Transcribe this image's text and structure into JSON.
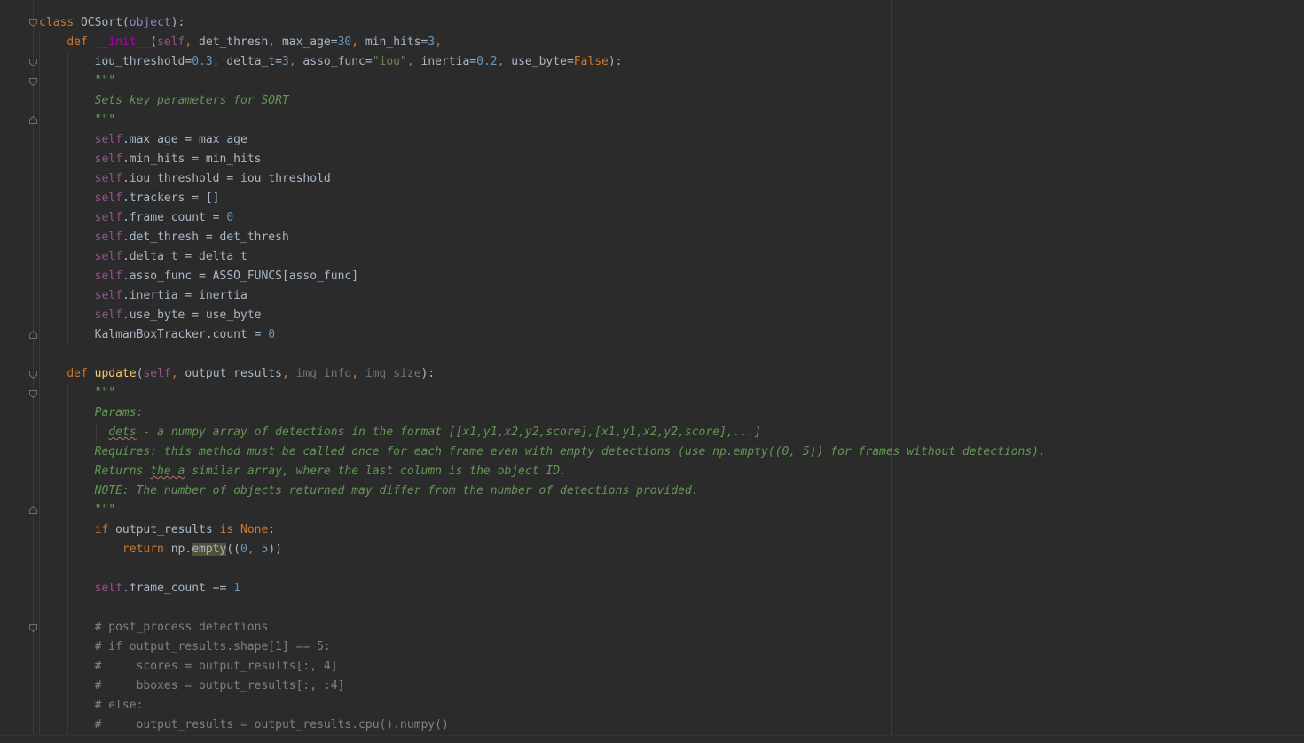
{
  "editor": {
    "language": "python",
    "lines": [
      "class OCSort(object):",
      "    def __init__(self, det_thresh, max_age=30, min_hits=3,",
      "        iou_threshold=0.3, delta_t=3, asso_func=\"iou\", inertia=0.2, use_byte=False):",
      "        \"\"\"",
      "        Sets key parameters for SORT",
      "        \"\"\"",
      "        self.max_age = max_age",
      "        self.min_hits = min_hits",
      "        self.iou_threshold = iou_threshold",
      "        self.trackers = []",
      "        self.frame_count = 0",
      "        self.det_thresh = det_thresh",
      "        self.delta_t = delta_t",
      "        self.asso_func = ASSO_FUNCS[asso_func]",
      "        self.inertia = inertia",
      "        self.use_byte = use_byte",
      "        KalmanBoxTracker.count = 0",
      "",
      "    def update(self, output_results, img_info, img_size):",
      "        \"\"\"",
      "        Params:",
      "          dets - a numpy array of detections in the format [[x1,y1,x2,y2,score],[x1,y1,x2,y2,score],...]",
      "        Requires: this method must be called once for each frame even with empty detections (use np.empty((0, 5)) for frames without detections).",
      "        Returns the a similar array, where the last column is the object ID.",
      "        NOTE: The number of objects returned may differ from the number of detections provided.",
      "        \"\"\"",
      "        if output_results is None:",
      "            return np.empty((0, 5))",
      "",
      "        self.frame_count += 1",
      "",
      "        # post_process detections",
      "        # if output_results.shape[1] == 5:",
      "        #     scores = output_results[:, 4]",
      "        #     bboxes = output_results[:, :4]",
      "        # else:",
      "        #     output_results = output_results.cpu().numpy()"
    ]
  },
  "colors": {
    "background": "#2b2b2b",
    "text": "#a9b7c6",
    "keyword": "#cc7832",
    "self": "#94558d",
    "number": "#6897bb",
    "string": "#6a8759",
    "docstring": "#629755",
    "comment": "#808080",
    "function": "#ffc66d",
    "magic": "#b200b2"
  },
  "fold_icons": [
    "fold-icon"
  ]
}
